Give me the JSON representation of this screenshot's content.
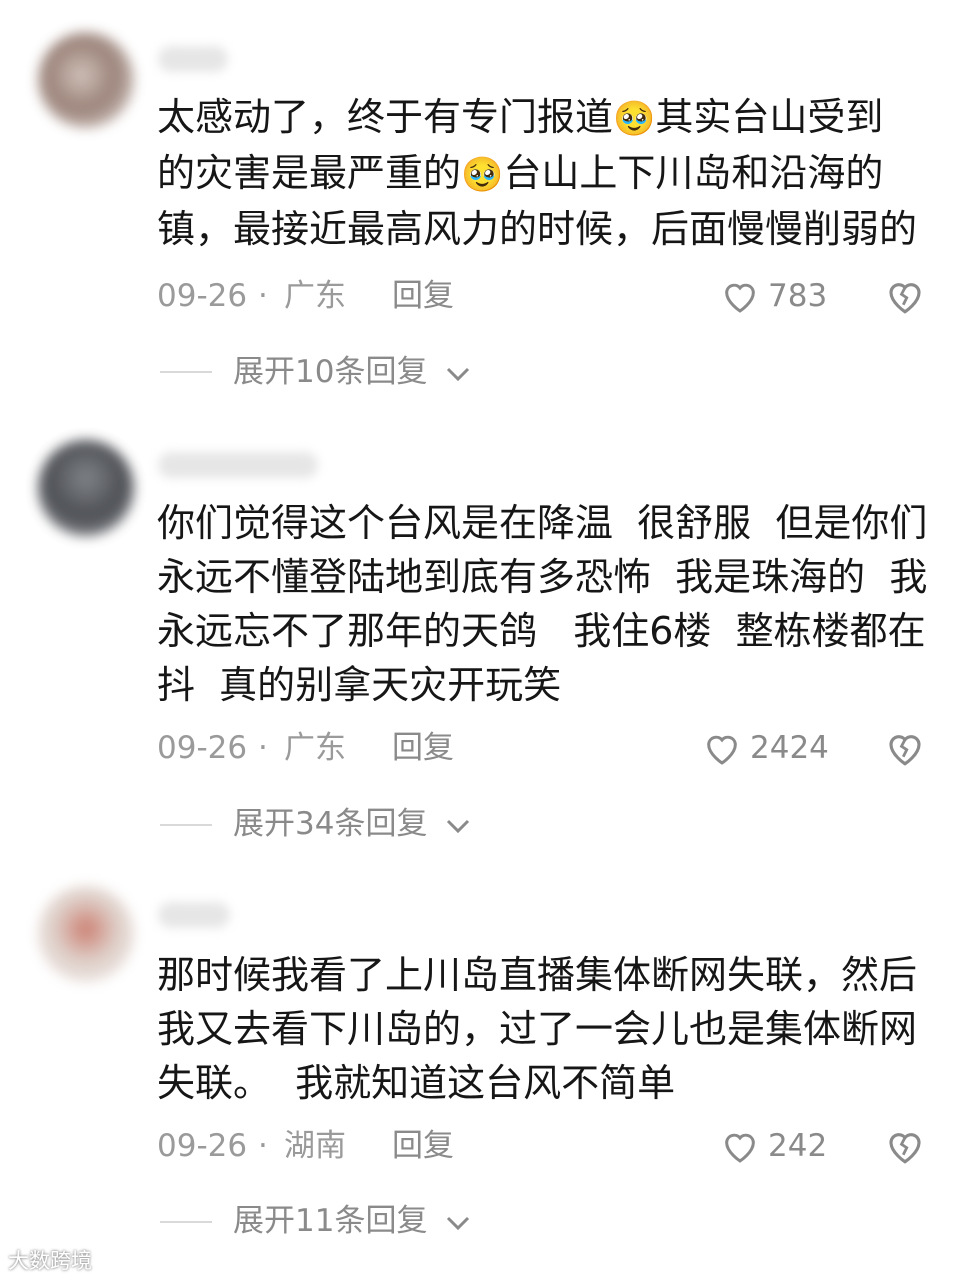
{
  "comments": [
    {
      "text_parts": [
        "太感动了，终于有专门报道",
        "🥹",
        "其实台山受到\n的灾害是最严重的",
        "🥹",
        "台山上下川岛和沿海的\n镇，最接近最高风力的时候，后面慢慢削弱的"
      ],
      "date": "09-26",
      "separator": "·",
      "location": "广东",
      "reply_label": "回复",
      "likes": "783",
      "expand_label": "展开10条回复"
    },
    {
      "text_parts": [
        "你们觉得这个台风是在降温  很舒服  但是你们\n永远不懂登陆地到底有多恐怖  我是珠海的  我\n永远忘不了那年的天鸽   我住6楼  整栋楼都在\n抖  真的别拿天灾开玩笑"
      ],
      "date": "09-26",
      "separator": "·",
      "location": "广东",
      "reply_label": "回复",
      "likes": "2424",
      "expand_label": "展开34条回复"
    },
    {
      "text_parts": [
        "那时候我看了上川岛直播集体断网失联，然后\n我又去看下川岛的，过了一会儿也是集体断网\n失联。  我就知道这台风不简单"
      ],
      "date": "09-26",
      "separator": "·",
      "location": "湖南",
      "reply_label": "回复",
      "likes": "242",
      "expand_label": "展开11条回复"
    }
  ],
  "watermark": "大数跨境",
  "icons": {
    "like": "heart-outline-icon",
    "dislike": "broken-heart-icon",
    "expand": "chevron-down-icon",
    "emoji": "pleading-face-emoji"
  },
  "colors": {
    "text": "#161616",
    "meta": "#9a9a9a",
    "icon": "#8a8a8a"
  }
}
